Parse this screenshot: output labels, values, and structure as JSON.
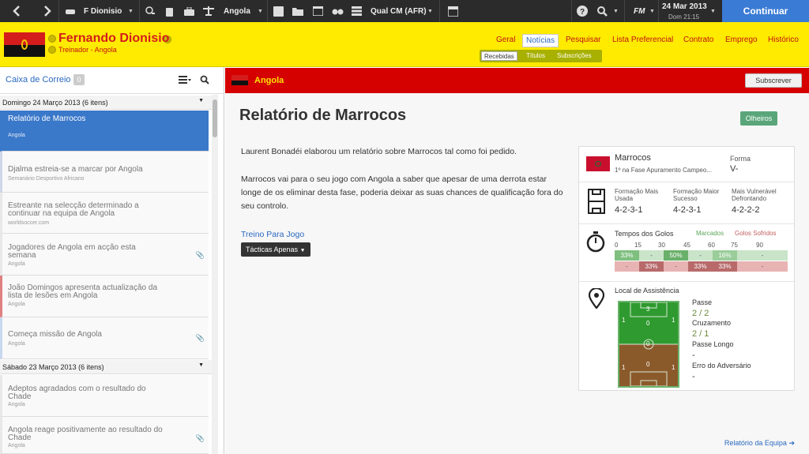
{
  "topbar": {
    "profile_name": "F Dionisio",
    "nation": "Angola",
    "competition": "Qual CM (AFR)",
    "date": "24 Mar 2013",
    "day_time": "Dom 21:15",
    "fm_label": "FM",
    "continue_label": "Continuar"
  },
  "header": {
    "manager_name": "Fernando Dionisio",
    "manager_role": "Treinador - Angola",
    "nav": [
      "Geral",
      "Notícias",
      "Pesquisar",
      "Lista Preferencial",
      "Contrato",
      "Emprego",
      "Histórico"
    ],
    "active_nav": "Notícias",
    "subnav": [
      "Recebidas",
      "Títulos",
      "Subscrições"
    ],
    "active_subnav": "Recebidas"
  },
  "inbox": {
    "title": "Caixa de Correio",
    "count": "0",
    "groups": [
      {
        "label": "Domingo 24 Março 2013 (6 itens)"
      },
      {
        "label": "Sábado 23 Março 2013 (6 itens)"
      }
    ],
    "messages": [
      {
        "title": "Relatório de Marrocos",
        "source": "Angola"
      },
      {
        "title": "Djalma estreia-se a marcar por Angola",
        "source": "Semanário Desportivo Africano"
      },
      {
        "title": "Estreante na selecção determinado a continuar na equipa de Angola",
        "source": "worldsoccer.com"
      },
      {
        "title": "Jogadores de Angola em acção esta semana",
        "source": "Angola"
      },
      {
        "title": "João Domingos apresenta actualização da lista de lesões em Angola",
        "source": "Angola"
      },
      {
        "title": "Começa missão de Angola",
        "source": "Angola"
      },
      {
        "title": "Adeptos agradados com o resultado do Chade",
        "source": "Angola"
      },
      {
        "title": "Angola reage positivamente ao resultado do Chade",
        "source": "Angola"
      }
    ]
  },
  "report": {
    "channel": "Angola",
    "subscribe_label": "Subscrever",
    "title": "Relatório de Marrocos",
    "others_label": "Olheiros",
    "paragraph1": "Laurent Bonadéi elaborou um relatório sobre Marrocos tal como foi pedido.",
    "paragraph2": "Marrocos vai para o seu jogo com Angola a saber que apesar de uma derrota estar longe de os eliminar desta fase, poderia deixar as suas chances de qualificação fora do seu controlo.",
    "training_link": "Treino Para Jogo",
    "tactics_button": "Tácticas Apenas",
    "team_report_link": "Relatório da Equipa"
  },
  "card": {
    "team": "Marrocos",
    "competition": "1º na Fase Apuramento Campeo...",
    "form_label": "Forma",
    "form_value": "V-",
    "formations": [
      {
        "label": "Formação Mais Usada",
        "value": "4-2-3-1"
      },
      {
        "label": "Formação Maior Sucesso",
        "value": "4-2-3-1"
      },
      {
        "label": "Mais Vulnerável Defrontando",
        "value": "4-2-2-2"
      }
    ],
    "goal_times": {
      "title": "Tempos dos Golos",
      "scored_label": "Marcados",
      "conceded_label": "Golos Sofridos",
      "minutes": [
        "0",
        "15",
        "30",
        "45",
        "60",
        "75",
        "90"
      ],
      "scored": [
        "33%",
        "-",
        "50%",
        "-",
        "16%",
        "-"
      ],
      "conceded": [
        "-",
        "33%",
        "-",
        "33%",
        "33%",
        "-"
      ]
    },
    "assists": {
      "title": "Local de Assistência",
      "stats": [
        {
          "label": "Passe",
          "value": "2 / 2"
        },
        {
          "label": "Cruzamento",
          "value": "2 / 1"
        },
        {
          "label": "Passe Longo",
          "value": "-"
        },
        {
          "label": "Erro do Adversário",
          "value": "-"
        }
      ],
      "pitch_numbers": [
        "3",
        "1",
        "1",
        "0",
        "0",
        "0",
        "1",
        "1"
      ]
    }
  }
}
